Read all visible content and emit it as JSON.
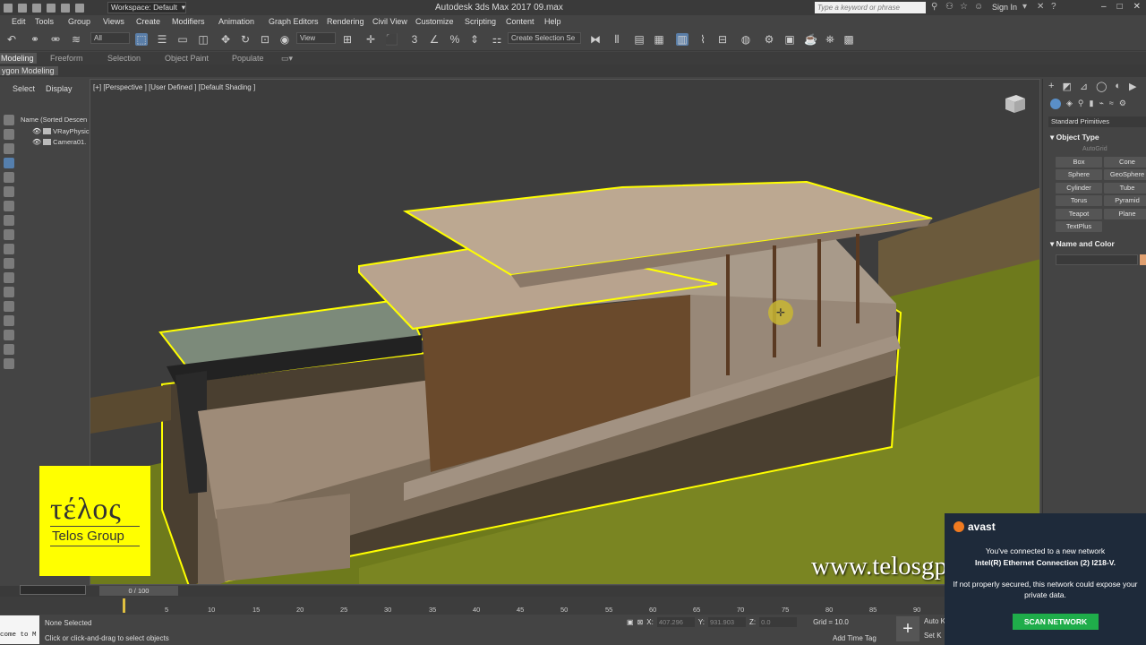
{
  "titlebar": {
    "workspace": "Workspace: Default",
    "app_title": "Autodesk 3ds Max 2017     09.max",
    "search_placeholder": "Type a keyword or phrase",
    "sign_in": "Sign In"
  },
  "menu": [
    "Edit",
    "Tools",
    "Group",
    "Views",
    "Create",
    "Modifiers",
    "Animation",
    "Graph Editors",
    "Rendering",
    "Civil View",
    "Customize",
    "Scripting",
    "Content",
    "Help"
  ],
  "toolbar": {
    "filter_select": "All",
    "ref_coord": "View",
    "named_selection": "Create Selection Se"
  },
  "ribbon": {
    "tabs": [
      "Modeling",
      "Freeform",
      "Selection",
      "Object Paint",
      "Populate"
    ],
    "sub": "ygon Modeling"
  },
  "explorer": {
    "tabs": [
      "Select",
      "Display"
    ],
    "column_header": "Name (Sorted Descen",
    "items": [
      "VRayPhysic",
      "Camera01."
    ]
  },
  "viewport": {
    "label": "[+] [Perspective ] [User Defined ] [Default Shading ]"
  },
  "command_panel": {
    "dropdown": "Standard Primitives",
    "rollout_object_type": "Object Type",
    "autogrid": "AutoGrid",
    "primitives": [
      "Box",
      "Cone",
      "Sphere",
      "GeoSphere",
      "Cylinder",
      "Tube",
      "Torus",
      "Pyramid",
      "Teapot",
      "Plane",
      "TextPlus"
    ],
    "rollout_name_color": "Name and Color",
    "swatch_color": "#e0a070"
  },
  "logo": {
    "greek": "τέλος",
    "group": "Telos Group"
  },
  "watermark": "www.telosgp.com",
  "timeline": {
    "frame_range": "0 / 100",
    "ticks": [
      "5",
      "10",
      "15",
      "20",
      "25",
      "30",
      "35",
      "40",
      "45",
      "50",
      "55",
      "60",
      "65",
      "70",
      "75",
      "80",
      "85",
      "90"
    ]
  },
  "status": {
    "maxscript": "come to M",
    "selection": "None Selected",
    "prompt": "Click or click-and-drag to select objects",
    "x_label": "X:",
    "x_value": "407.296",
    "y_label": "Y:",
    "y_value": "931.903",
    "z_label": "Z:",
    "z_value": "0.0",
    "grid": "Grid = 10.0",
    "add_time_tag": "Add Time Tag",
    "auto_key": "Auto K",
    "set_key": "Set K"
  },
  "avast": {
    "brand": "avast",
    "line1": "You've connected to a new network",
    "line2": "Intel(R) Ethernet Connection (2) I218-V.",
    "line3": "If not properly secured, this network could expose your private data.",
    "button": "SCAN NETWORK"
  },
  "colors": {
    "selection_outline": "#ffff00",
    "logo_bg": "#ffff00",
    "avast_button": "#1fad4a"
  }
}
